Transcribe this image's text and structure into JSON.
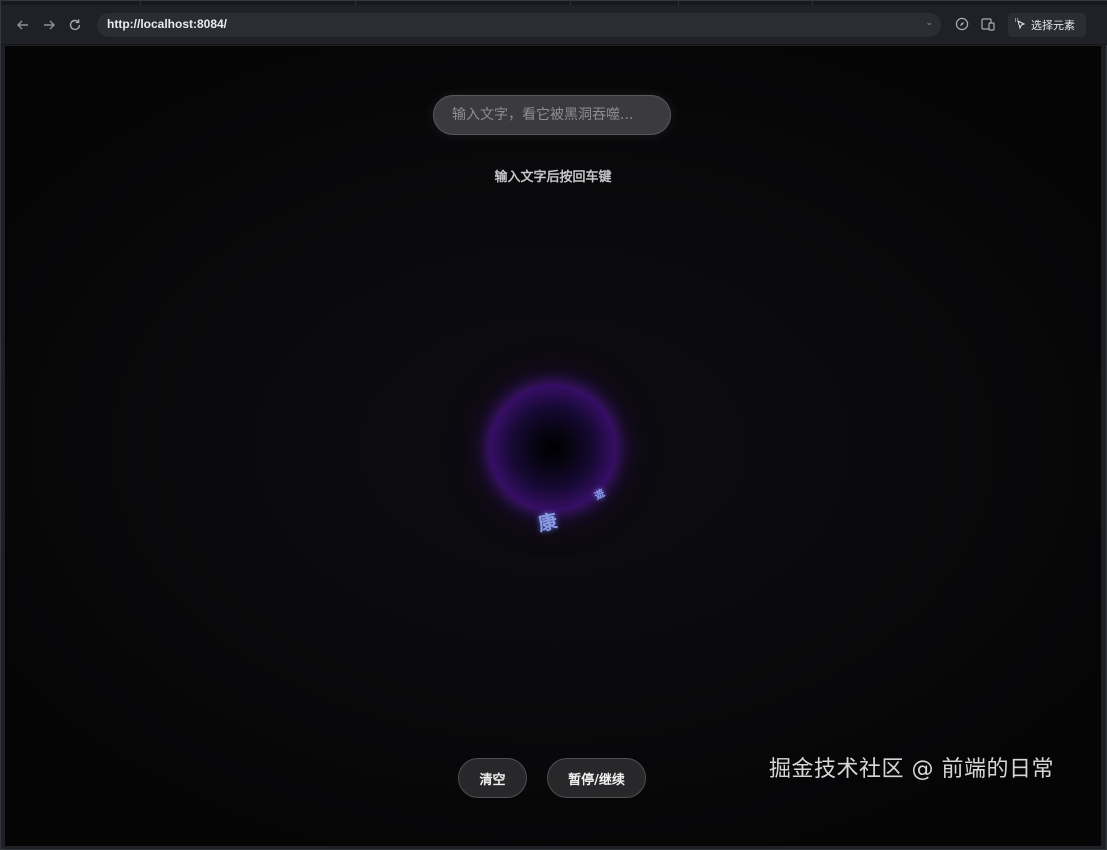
{
  "browser": {
    "url": "http://localhost:8084/",
    "select_element_label": "选择元素"
  },
  "page": {
    "input_placeholder": "输入文字，看它被黑洞吞噬...",
    "hint": "输入文字后按回车键",
    "orbit_chars": [
      "康",
      "遊"
    ],
    "buttons": {
      "clear": "清空",
      "pause_resume": "暂停/继续"
    }
  },
  "watermark": "掘金技术社区 @ 前端的日常",
  "colors": {
    "blackhole_glow": "#5a13a1",
    "orbit_text": "#8a9be6",
    "background": "#0a0a0c"
  },
  "icons": [
    "back-arrow-icon",
    "forward-arrow-icon",
    "reload-icon",
    "chevron-down-icon",
    "compass-icon",
    "device-toolbar-icon",
    "cursor-select-icon"
  ]
}
